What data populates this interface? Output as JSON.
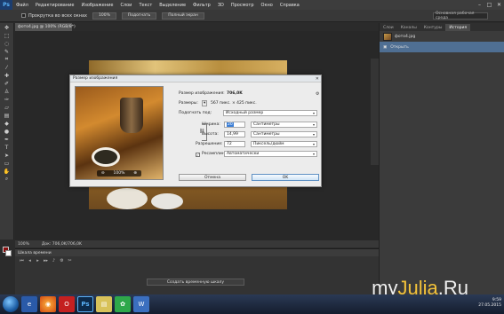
{
  "menubar": {
    "logo": "Ps",
    "items": [
      "Файл",
      "Редактирование",
      "Изображение",
      "Слои",
      "Текст",
      "Выделение",
      "Фильтр",
      "3D",
      "Просмотр",
      "Окно",
      "Справка"
    ]
  },
  "options_bar": {
    "scroll_all_windows": "Прокрутка во всех окнах",
    "btn_100": "100%",
    "btn_fit_screen": "Подогнать",
    "btn_full_screen": "Полный экран",
    "workspace": "Основная рабочая среда"
  },
  "document": {
    "tab": "фото4.jpg @ 100% (RGB/8*)"
  },
  "status_bar": {
    "zoom": "100%",
    "doc_info": "Док: 706,0K/706,0K"
  },
  "timeline": {
    "title": "Шкала времени",
    "create_video_button": "Создать временную шкалу"
  },
  "right_panel": {
    "tabs": [
      "Слои",
      "Каналы",
      "Контуры",
      "История"
    ],
    "active_tab": "История",
    "history_snapshot": "фото4.jpg",
    "history_item": "Открыть"
  },
  "dialog": {
    "title": "Размер изображения",
    "image_size_label": "Размер изображения:",
    "image_size_value": "706,0K",
    "dimensions_label": "Размеры:",
    "dimensions_value": "567 пикс. × 425 пикс.",
    "fit_to_label": "Подогнать под:",
    "fit_to_value": "Исходный размер",
    "width_label": "Ширина:",
    "width_value": "20",
    "width_unit": "Сантиметры",
    "height_label": "Высота:",
    "height_value": "14,99",
    "height_unit": "Сантиметры",
    "resolution_label": "Разрешение:",
    "resolution_value": "72",
    "resolution_unit": "Пиксель/дюйм",
    "resample_label": "Ресамплинг:",
    "resample_value": "Автоматически",
    "preview_zoom": "100%",
    "cancel_button": "Отмена",
    "ok_button": "OK"
  },
  "watermark": {
    "part1": "my",
    "part2": "Julia",
    "part3": ".Ru",
    "color1": "#f0f0f0",
    "color2": "#f3c23a"
  },
  "clock": {
    "time": "9:59",
    "date": "27.05.2015"
  }
}
